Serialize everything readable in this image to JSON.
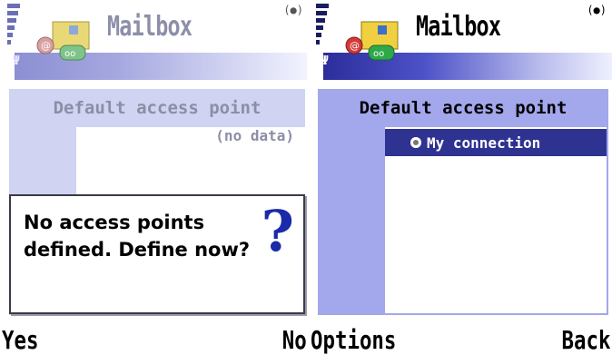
{
  "screen_left": {
    "title": "Mailbox",
    "list_header": "Default access point",
    "empty_text": "(no data)",
    "dialog": {
      "text": "No access points defined. Define now?",
      "icon": "question-mark-icon"
    },
    "softkeys": {
      "left": "Yes",
      "right": "No"
    }
  },
  "screen_right": {
    "title": "Mailbox",
    "list_header": "Default access point",
    "items": [
      {
        "label": "My connection",
        "selected": true
      }
    ],
    "softkeys": {
      "left": "Options",
      "right": "Back"
    }
  },
  "colors": {
    "accent": "#2e3290",
    "panel": "#a3a7ec",
    "question_mark": "#1a2aa8"
  },
  "icons": [
    "signal-strength-icon",
    "mailbox-icon",
    "antenna-icon",
    "radio-icon"
  ]
}
